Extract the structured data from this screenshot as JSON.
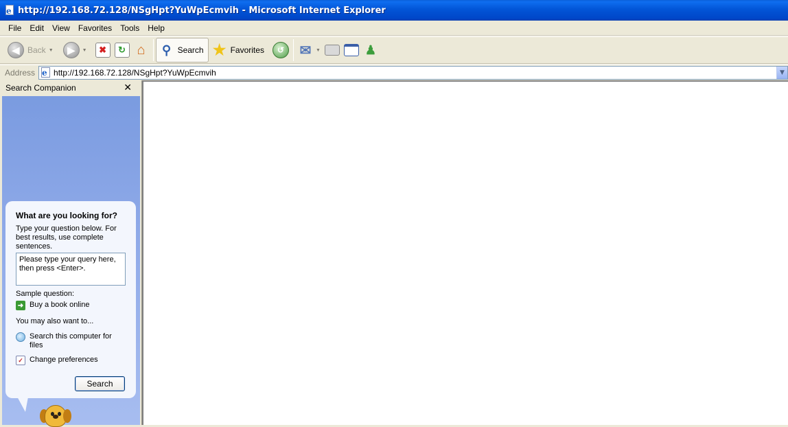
{
  "window": {
    "title": "http://192.168.72.128/NSgHpt?YuWpEcmvih - Microsoft Internet Explorer"
  },
  "menu": [
    "File",
    "Edit",
    "View",
    "Favorites",
    "Tools",
    "Help"
  ],
  "toolbar": {
    "back_label": "Back",
    "search_label": "Search",
    "favorites_label": "Favorites"
  },
  "address": {
    "label": "Address",
    "url": "http://192.168.72.128/NSgHpt?YuWpEcmvih"
  },
  "search_companion": {
    "title": "Search Companion",
    "heading": "What are you looking for?",
    "instructions": "Type your question below. For best results, use complete sentences.",
    "query_placeholder": "Please type your query here, then press <Enter>.",
    "sample_label": "Sample question:",
    "sample_link": "Buy a book online",
    "also_label": "You may also want to...",
    "links": [
      "Search this computer for files",
      "Change preferences"
    ],
    "search_button": "Search"
  },
  "colors": {
    "titlebar": "#0255d7",
    "chrome": "#ece9d8",
    "pane_gradient_top": "#7a9be0",
    "bubble": "#f3f6fd"
  }
}
